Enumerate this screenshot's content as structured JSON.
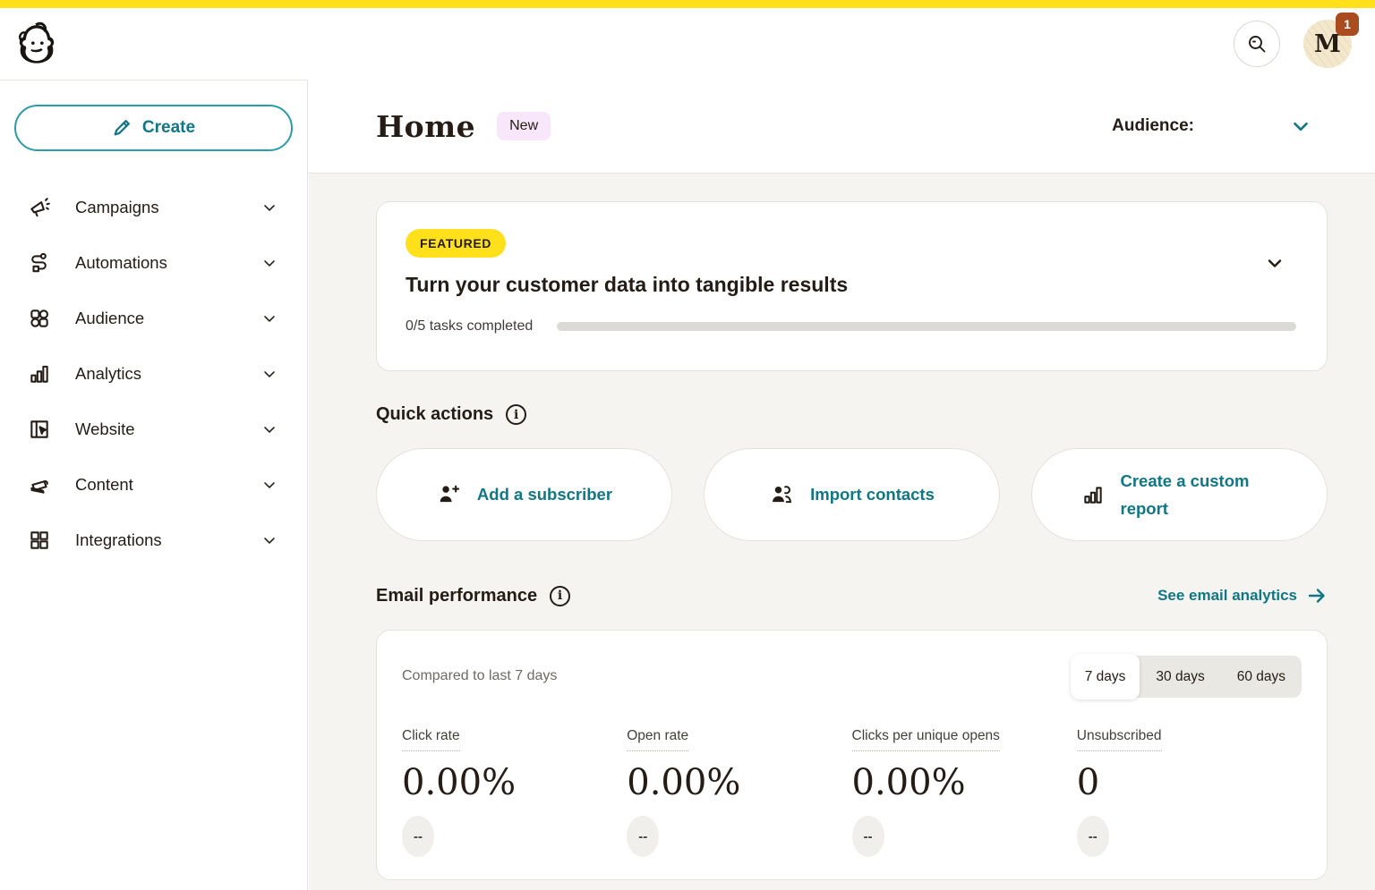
{
  "topbar": {
    "notification_count": "1",
    "avatar_initial": "M"
  },
  "sidebar": {
    "create_label": "Create",
    "items": [
      {
        "label": "Campaigns",
        "icon": "megaphone-icon"
      },
      {
        "label": "Automations",
        "icon": "workflow-icon"
      },
      {
        "label": "Audience",
        "icon": "people-grid-icon"
      },
      {
        "label": "Analytics",
        "icon": "bar-chart-icon"
      },
      {
        "label": "Website",
        "icon": "browser-cursor-icon"
      },
      {
        "label": "Content",
        "icon": "papers-icon"
      },
      {
        "label": "Integrations",
        "icon": "grid-icon"
      }
    ]
  },
  "page_header": {
    "title": "Home",
    "new_badge": "New",
    "audience_label": "Audience:"
  },
  "featured": {
    "badge": "FEATURED",
    "title": "Turn your customer data into tangible results",
    "progress_label": "0/5 tasks completed",
    "progress_percent": 0
  },
  "quick_actions": {
    "heading": "Quick actions",
    "cards": [
      {
        "label": "Add a subscriber",
        "icon": "person-add-icon"
      },
      {
        "label": "Import contacts",
        "icon": "people-icon"
      },
      {
        "label": "Create a custom report",
        "icon": "report-chart-icon"
      }
    ]
  },
  "email_performance": {
    "heading": "Email performance",
    "analytics_link": "See email analytics",
    "compared_label": "Compared to last 7 days",
    "tabs": [
      {
        "label": "7 days",
        "active": true
      },
      {
        "label": "30 days",
        "active": false
      },
      {
        "label": "60 days",
        "active": false
      }
    ],
    "stats": [
      {
        "label": "Click rate",
        "value": "0.00%",
        "delta": "--"
      },
      {
        "label": "Open rate",
        "value": "0.00%",
        "delta": "--"
      },
      {
        "label": "Clicks per unique opens",
        "value": "0.00%",
        "delta": "--"
      },
      {
        "label": "Unsubscribed",
        "value": "0",
        "delta": "--"
      }
    ]
  },
  "colors": {
    "brand_yellow": "#ffe01b",
    "teal": "#007c89",
    "text": "#241c15",
    "muted_text": "#6e6a64",
    "page_bg": "#f5f4f1",
    "card_border": "#e4e2dd",
    "new_badge_bg": "#f8e6fa",
    "notification_bg": "#a94c20",
    "avatar_bg": "#f4e8cc"
  }
}
